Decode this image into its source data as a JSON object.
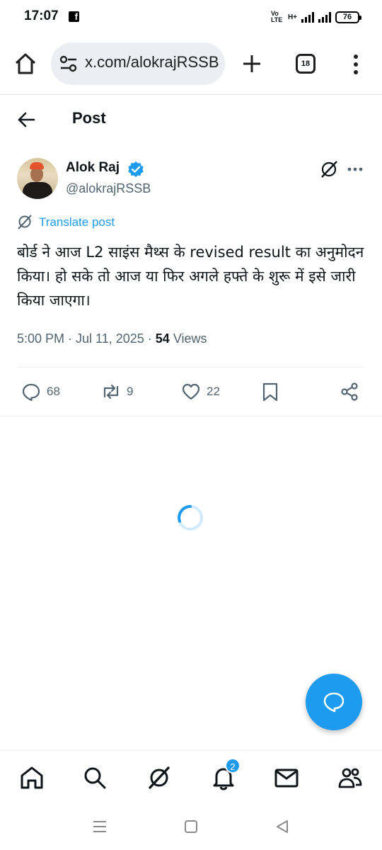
{
  "status_bar": {
    "time": "17:07",
    "fb_glyph": "f",
    "volte": "Vo LTE",
    "net_type": "H+",
    "battery": "76"
  },
  "browser": {
    "url": "x.com/alokrajRSSB",
    "tab_count": "18"
  },
  "header": {
    "title": "Post"
  },
  "post": {
    "author_name": "Alok Raj",
    "author_handle": "@alokrajRSSB",
    "translate_label": "Translate post",
    "text": "बोर्ड ने आज L2 साइंस मैथ्स के revised result का अनुमोदन किया। हो सके तो आज या फिर अगले हफ्ते के शुरू में इसे जारी किया जाएगा।",
    "timestamp": "5:00 PM · Jul 11, 2025 · ",
    "views_count": "54",
    "views_label": "Views"
  },
  "actions": {
    "replies": "68",
    "reposts": "9",
    "likes": "22"
  },
  "bottom_nav": {
    "notifications_badge": "2"
  },
  "colors": {
    "accent": "#1d9bf0",
    "secondary_text": "#536471",
    "primary_text": "#0f1419"
  },
  "icons": [
    "home-icon",
    "tune-icon",
    "plus-icon",
    "tabs-icon",
    "overflow-menu-icon",
    "back-arrow-icon",
    "verified-badge-icon",
    "grok-icon",
    "more-icon",
    "translate-icon",
    "reply-icon",
    "repost-icon",
    "like-icon",
    "bookmark-icon",
    "share-icon",
    "loading-spinner",
    "chat-bubble-icon",
    "search-icon",
    "bell-icon",
    "mail-icon",
    "communities-icon"
  ]
}
